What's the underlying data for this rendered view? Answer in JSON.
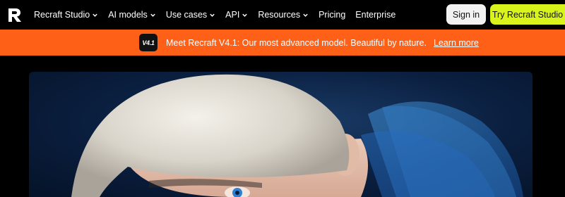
{
  "nav": {
    "logo_icon": "recraft-logo-icon",
    "items": [
      {
        "label": "Recraft Studio",
        "has_dropdown": true
      },
      {
        "label": "AI models",
        "has_dropdown": true
      },
      {
        "label": "Use cases",
        "has_dropdown": true
      },
      {
        "label": "API",
        "has_dropdown": true
      },
      {
        "label": "Resources",
        "has_dropdown": true
      },
      {
        "label": "Pricing",
        "has_dropdown": false
      },
      {
        "label": "Enterprise",
        "has_dropdown": false
      }
    ],
    "sign_in_label": "Sign in",
    "try_label": "Try Recraft Studio"
  },
  "banner": {
    "badge_text": "V4.1",
    "message": "Meet Recraft V4.1: Our most advanced model. Beautiful by nature.",
    "link_label": "Learn more",
    "color": "#ff6018"
  },
  "hero": {
    "image_description_icon": "portrait-photo-image"
  },
  "colors": {
    "background": "#000000",
    "accent": "#d9f41b",
    "banner": "#ff6018"
  }
}
